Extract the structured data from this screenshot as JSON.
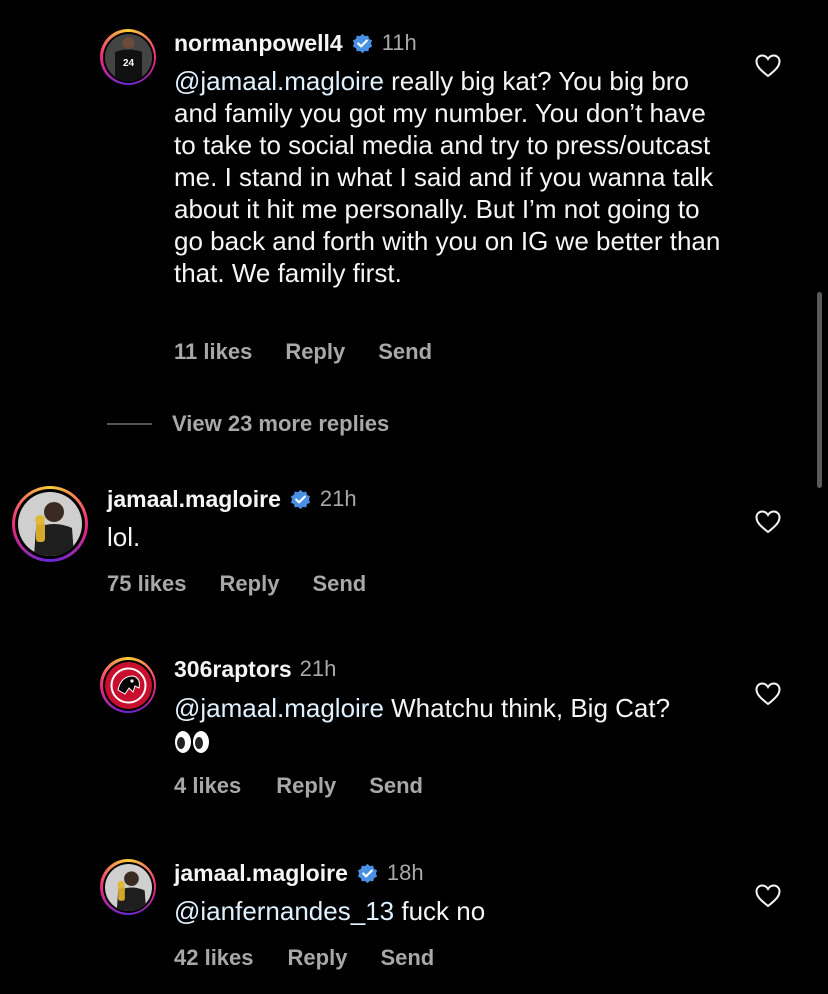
{
  "comments": [
    {
      "username": "normanpowell4",
      "verified": true,
      "time": "11h",
      "mention": "@jamaal.magloire",
      "text": " really big kat? You big bro and family you got my number. You don’t have to take to social media and try to press/outcast me. I stand in what I said and if you wanna talk about it hit me personally. But I’m not going to go back and forth with you on IG we better than that.  We family first.",
      "likes": "11 likes",
      "reply": "Reply",
      "send": "Send",
      "avatar_jersey_number": "24"
    },
    {
      "username": "jamaal.magloire",
      "verified": true,
      "time": "21h",
      "text": "lol.",
      "likes": "75 likes",
      "reply": "Reply",
      "send": "Send"
    },
    {
      "username": "306raptors",
      "verified": false,
      "time": "21h",
      "mention": "@jamaal.magloire",
      "text": " Whatchu think, Big Cat? ",
      "emoji": "eyes",
      "likes": "4 likes",
      "reply": "Reply",
      "send": "Send"
    },
    {
      "username": "jamaal.magloire",
      "verified": true,
      "time": "18h",
      "mention": "@ianfernandes_13",
      "text": " fuck no",
      "likes": "42 likes",
      "reply": "Reply",
      "send": "Send"
    }
  ],
  "view_more": "View 23 more replies",
  "colors": {
    "background": "#000000",
    "text": "#f5f5f5",
    "secondary": "#a8a8a8",
    "verified": "#4a90e2",
    "raptors_red": "#c8102e"
  }
}
